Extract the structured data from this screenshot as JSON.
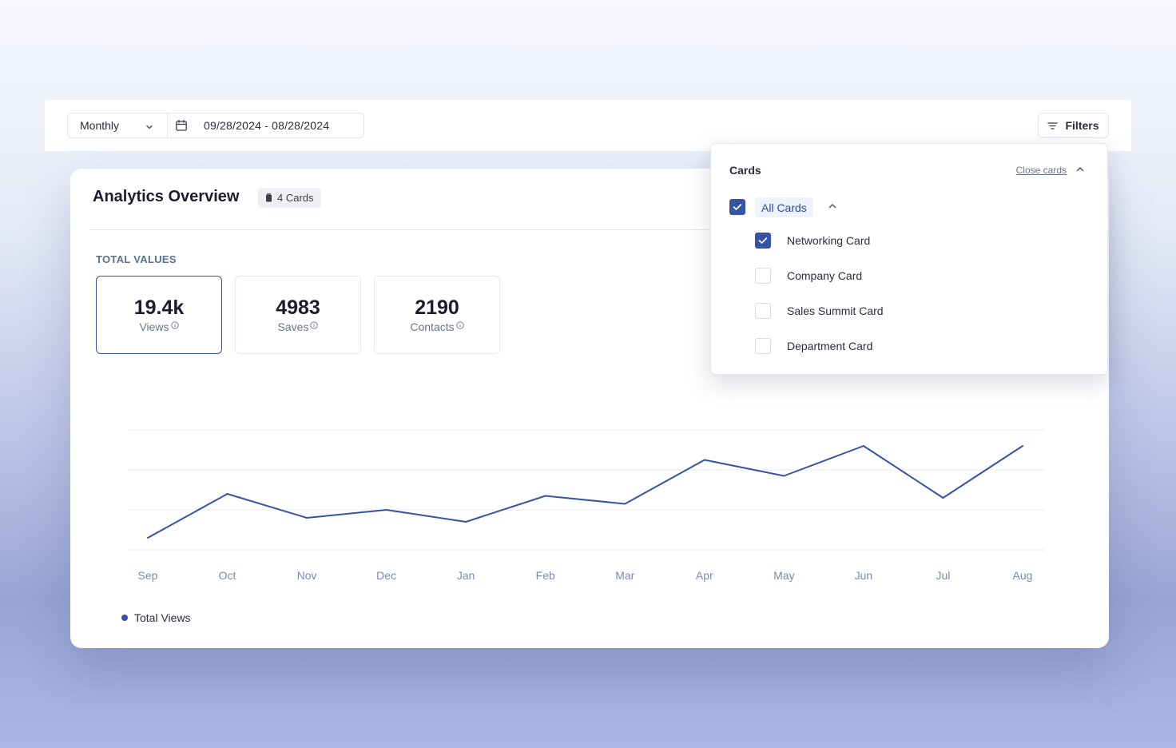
{
  "toolbar": {
    "period": "Monthly",
    "date_range": "09/28/2024 - 08/28/2024",
    "filters_label": "Filters"
  },
  "overview": {
    "title": "Analytics Overview",
    "cards_badge": "4 Cards",
    "section_label": "TOTAL VALUES",
    "stats": [
      {
        "value": "19.4k",
        "label": "Views",
        "active": true
      },
      {
        "value": "4983",
        "label": "Saves",
        "active": false
      },
      {
        "value": "2190",
        "label": "Contacts",
        "active": false
      }
    ]
  },
  "dropdown": {
    "title": "Cards",
    "close_label": "Close cards",
    "all_label": "All Cards",
    "all_checked": true,
    "options": [
      {
        "label": "Networking Card",
        "checked": true
      },
      {
        "label": "Company Card",
        "checked": false
      },
      {
        "label": "Sales Summit Card",
        "checked": false
      },
      {
        "label": "Department Card",
        "checked": false
      }
    ]
  },
  "colors": {
    "accent": "#3753a4",
    "grid": "#e8e9f0",
    "axis_text": "#7d8ab0"
  },
  "chart_data": {
    "type": "line",
    "categories": [
      "Sep",
      "Oct",
      "Nov",
      "Dec",
      "Jan",
      "Feb",
      "Mar",
      "Apr",
      "May",
      "Jun",
      "Jul",
      "Aug"
    ],
    "series": [
      {
        "name": "Total Views",
        "values": [
          0.3,
          1.4,
          0.8,
          1.0,
          0.7,
          1.35,
          1.15,
          2.25,
          1.85,
          2.6,
          1.3,
          2.6
        ]
      }
    ],
    "ylim": [
      0,
      3
    ],
    "grid": true,
    "legend": "bottom-left",
    "xlabel": "",
    "ylabel": ""
  }
}
